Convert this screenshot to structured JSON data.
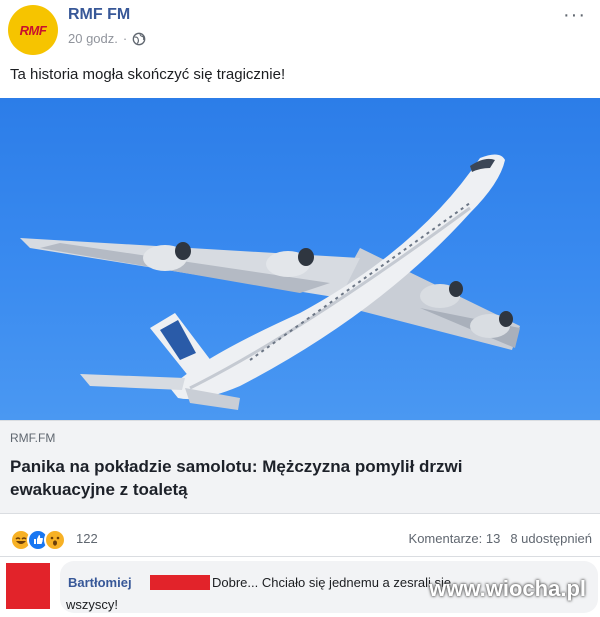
{
  "post": {
    "page_name": "RMF FM",
    "logo_text": "RMF",
    "time": "20 godz.",
    "separator": "·",
    "text": "Ta historia mogła skończyć się tragicznie!",
    "more_label": "···"
  },
  "link": {
    "domain": "RMF.FM",
    "title": "Panika na pokładzie samolotu: Mężczyzna pomylił drzwi ewakuacyjne z toaletą"
  },
  "reactions": {
    "icons": [
      "haha-emoji-icon",
      "like-icon",
      "wow-emoji-icon"
    ],
    "count": "122",
    "comments": "Komentarze: 13",
    "shares": "8 udostępnień"
  },
  "comment": {
    "author": "Bartłomiej",
    "text_line1": "Dobre... Chciało się jednemu a zesrali się",
    "text_line2": "wszyscy!"
  },
  "watermark": "www.wiocha.pl",
  "colors": {
    "link_blue": "#385898",
    "sky": "#3a8bf0",
    "avatar_red": "#e2232a",
    "logo_yellow": "#f6c400"
  }
}
